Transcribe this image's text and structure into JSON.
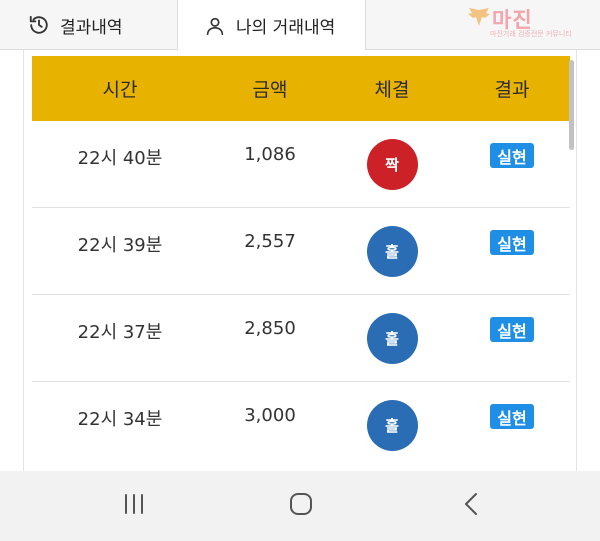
{
  "tabs": {
    "history_label": "결과내역",
    "mine_label": "나의 거래내역",
    "history_icon": "history-icon",
    "mine_icon": "person-icon"
  },
  "logo": {
    "main": "마진",
    "sub": "마진거래 검증전문 커뮤니티",
    "icon": "wings-emblem-icon"
  },
  "table": {
    "headers": [
      "시간",
      "금액",
      "체결",
      "결과"
    ],
    "rows": [
      {
        "time": "22시 40분",
        "amount": "1,086",
        "outcome": "짝",
        "outcome_color": "#cc2127",
        "result": "실현"
      },
      {
        "time": "22시 39분",
        "amount": "2,557",
        "outcome": "홀",
        "outcome_color": "#2a6db5",
        "result": "실현"
      },
      {
        "time": "22시 37분",
        "amount": "2,850",
        "outcome": "홀",
        "outcome_color": "#2a6db5",
        "result": "실현"
      },
      {
        "time": "22시 34분",
        "amount": "3,000",
        "outcome": "홀",
        "outcome_color": "#2a6db5",
        "result": "실현"
      }
    ]
  },
  "colors": {
    "header_bg": "#e8b200",
    "badge_bg": "#1f8fe6",
    "even_color": "#cc2127",
    "odd_color": "#2a6db5"
  },
  "navbar": {
    "recent_icon": "recent-apps-icon",
    "home_icon": "home-icon",
    "back_icon": "back-icon"
  }
}
